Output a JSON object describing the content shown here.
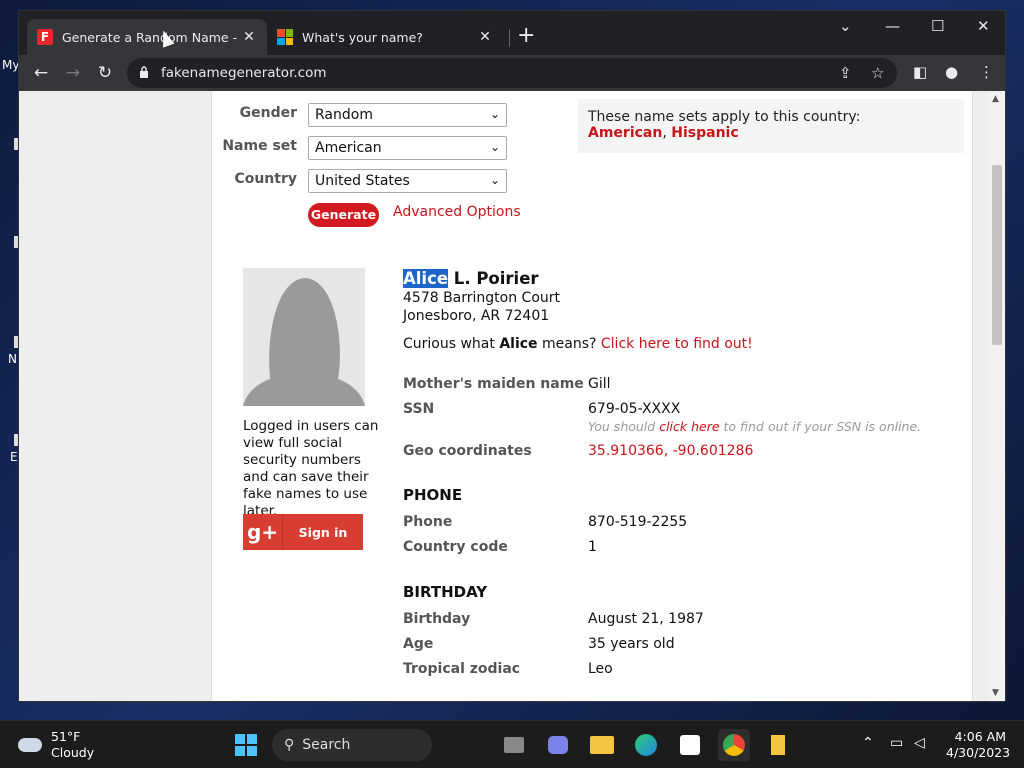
{
  "desktop": {
    "icon_labels": [
      "My",
      "N",
      "E"
    ]
  },
  "browser": {
    "tabs": [
      {
        "title": "Generate a Random Name - Fake",
        "close": "✕"
      },
      {
        "title": "What's your name?",
        "close": "✕"
      }
    ],
    "new_tab": "+",
    "url": "fakenamegenerator.com"
  },
  "form": {
    "gender_label": "Gender",
    "gender_value": "Random",
    "nameset_label": "Name set",
    "nameset_value": "American",
    "country_label": "Country",
    "country_value": "United States",
    "generate_label": "Generate",
    "advanced_label": "Advanced Options"
  },
  "nameset_info": {
    "text": "These name sets apply to this country:",
    "sets": [
      "American",
      "Hispanic"
    ]
  },
  "sidebar": {
    "logged_text": "Logged in users can view full social security numbers and can save their fake names to use later.",
    "signin_label": "Sign in",
    "gplus_icon": "g+"
  },
  "identity": {
    "first_name": "Alice",
    "rest_name": " L. Poirier",
    "address1": "4578 Barrington Court",
    "address2": "Jonesboro, AR 72401",
    "curious_prefix": "Curious what ",
    "curious_name": "Alice",
    "curious_suffix": " means? ",
    "curious_link": "Click here to find out!"
  },
  "details": {
    "maiden_label": "Mother's maiden name",
    "maiden_value": "Gill",
    "ssn_label": "SSN",
    "ssn_value": "679-05-XXXX",
    "ssn_note_prefix": "You should ",
    "ssn_note_link": "click here",
    "ssn_note_suffix": " to find out if your SSN is online.",
    "geo_label": "Geo coordinates",
    "geo_value": "35.910366, -90.601286"
  },
  "phone": {
    "section": "PHONE",
    "phone_label": "Phone",
    "phone_value": "870-519-2255",
    "cc_label": "Country code",
    "cc_value": "1"
  },
  "birthday": {
    "section": "BIRTHDAY",
    "birthday_label": "Birthday",
    "birthday_value": "August 21, 1987",
    "age_label": "Age",
    "age_value": "35 years old",
    "zodiac_label": "Tropical zodiac",
    "zodiac_value": "Leo"
  },
  "taskbar": {
    "temp": "51°F",
    "condition": "Cloudy",
    "search": "Search",
    "time": "4:06 AM",
    "date": "4/30/2023"
  }
}
